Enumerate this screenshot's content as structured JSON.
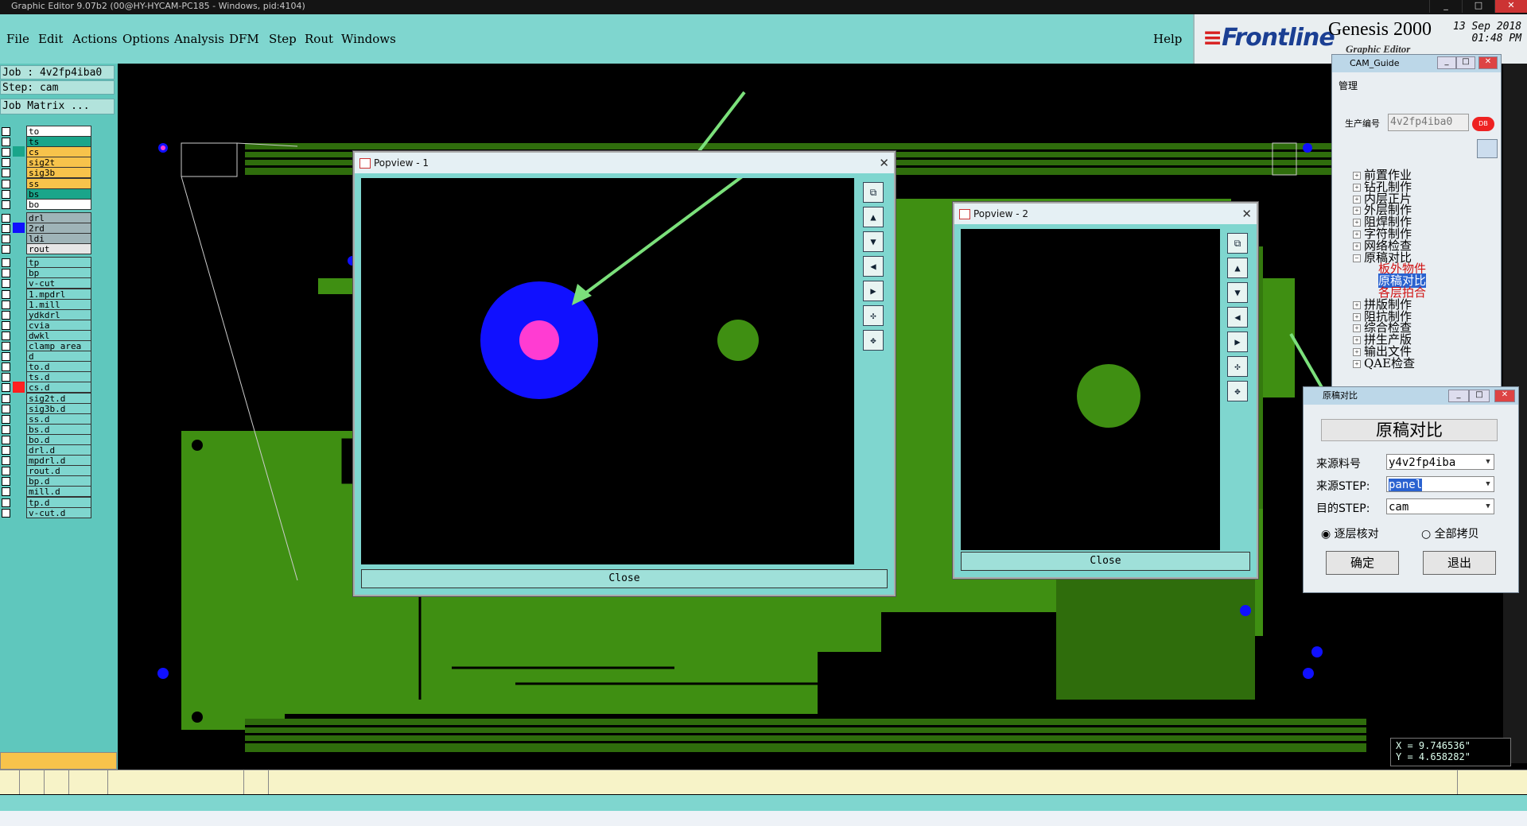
{
  "window": {
    "title": "Graphic Editor 9.07b2 (00@HY-HYCAM-PC185 - Windows, pid:4104)"
  },
  "menu": {
    "items": [
      "File",
      "Edit",
      "Actions",
      "Options",
      "Analysis",
      "DFM",
      "Step",
      "Rout",
      "Windows"
    ],
    "help": "Help"
  },
  "brand": {
    "logo_text": "Frontline",
    "product": "Genesis 2000",
    "subtitle": "Graphic Editor",
    "date": "13 Sep 2018",
    "time": "01:48 PM"
  },
  "job": {
    "job_label": "Job : 4v2fp4iba0",
    "step_label": "Step: cam",
    "matrix_button": "Job Matrix ..."
  },
  "layers": [
    {
      "name": "to",
      "color": "#ffffff"
    },
    {
      "name": "ts",
      "color": "#1aa58a"
    },
    {
      "name": "cs",
      "color": "#f7c34b"
    },
    {
      "name": "sig2t",
      "color": "#f7c34b"
    },
    {
      "name": "sig3b",
      "color": "#f7c34b"
    },
    {
      "name": "ss",
      "color": "#f7c34b"
    },
    {
      "name": "bs",
      "color": "#1aa58a"
    },
    {
      "name": "bo",
      "color": "#ffffff"
    },
    {
      "name": "drl",
      "color": "#9fb4b8"
    },
    {
      "name": "2rd",
      "color": "#9fb4b8"
    },
    {
      "name": "ldi",
      "color": "#9fb4b8"
    },
    {
      "name": "rout",
      "color": "#e6e6e6"
    },
    {
      "name": "tp",
      "color": "#7fd6cf"
    },
    {
      "name": "bp",
      "color": "#7fd6cf"
    },
    {
      "name": "v-cut",
      "color": "#7fd6cf"
    },
    {
      "name": "1.mpdrl",
      "color": "#7fd6cf"
    },
    {
      "name": "1.mill",
      "color": "#7fd6cf"
    },
    {
      "name": "ydkdrl",
      "color": "#7fd6cf"
    },
    {
      "name": "cvia",
      "color": "#7fd6cf"
    },
    {
      "name": "dwkl",
      "color": "#7fd6cf"
    },
    {
      "name": "clamp_area",
      "color": "#7fd6cf"
    },
    {
      "name": "d",
      "color": "#7fd6cf"
    },
    {
      "name": "to.d",
      "color": "#7fd6cf"
    },
    {
      "name": "ts.d",
      "color": "#7fd6cf"
    },
    {
      "name": "cs.d",
      "color": "#7fd6cf"
    },
    {
      "name": "sig2t.d",
      "color": "#7fd6cf"
    },
    {
      "name": "sig3b.d",
      "color": "#7fd6cf"
    },
    {
      "name": "ss.d",
      "color": "#7fd6cf"
    },
    {
      "name": "bs.d",
      "color": "#7fd6cf"
    },
    {
      "name": "bo.d",
      "color": "#7fd6cf"
    },
    {
      "name": "drl.d",
      "color": "#7fd6cf"
    },
    {
      "name": "mpdrl.d",
      "color": "#7fd6cf"
    },
    {
      "name": "rout.d",
      "color": "#7fd6cf"
    },
    {
      "name": "bp.d",
      "color": "#7fd6cf"
    },
    {
      "name": "mill.d",
      "color": "#7fd6cf"
    },
    {
      "name": "tp.d",
      "color": "#7fd6cf"
    },
    {
      "name": "v-cut.d",
      "color": "#7fd6cf"
    }
  ],
  "popview1": {
    "title": "Popview - 1",
    "close_label": "Close"
  },
  "popview2": {
    "title": "Popview - 2",
    "close_label": "Close"
  },
  "cam_guide": {
    "title": "CAM_Guide",
    "tab": "管理",
    "prod_label": "生产编号",
    "prod_value": "4v2fp4iba0",
    "tree": [
      "前置作业",
      "钻孔制作",
      "内层正片",
      "外层制作",
      "阻焊制作",
      "字符制作",
      "网络检查",
      "原稿对比",
      "板外物件",
      "原稿对比",
      "各层拍合",
      "拼版制作",
      "阻抗制作",
      "综合检查",
      "拼生产版",
      "输出文件",
      "QAE检查"
    ]
  },
  "compare_dialog": {
    "title": "原稿对比",
    "heading": "原稿对比",
    "src_job_label": "来源料号",
    "src_job_value": "y4v2fp4iba",
    "src_step_label": "来源STEP:",
    "src_step_value": "panel",
    "dst_step_label": "目的STEP:",
    "dst_step_value": "cam",
    "radio1": "逐层核对",
    "radio2": "全部拷贝",
    "ok": "确定",
    "exit": "退出"
  },
  "coords": {
    "x": "X = 9.746536\"",
    "y": "Y = 4.658282\""
  },
  "colors": {
    "panel": "#7fd6cf",
    "board": "#3f8f12",
    "pad_blue": "#1010ff",
    "pad_magenta": "#ff3cd2",
    "arrow": "#7be07b"
  }
}
